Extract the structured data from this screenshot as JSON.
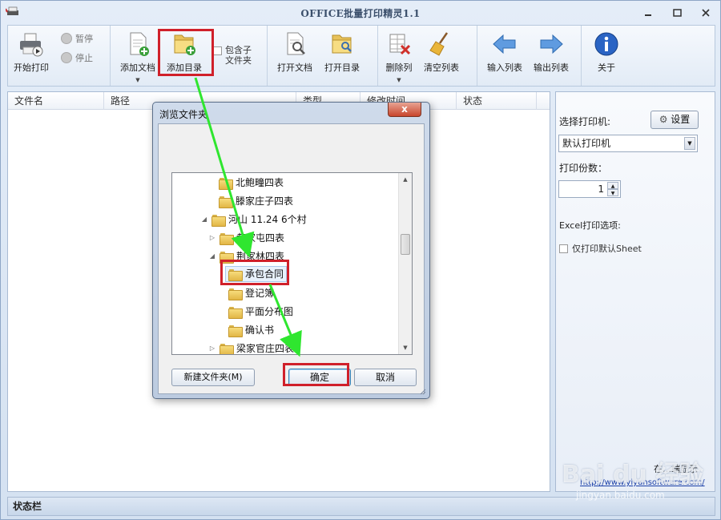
{
  "window": {
    "title": "OFFICE批量打印精灵1.1",
    "min": "▫",
    "max": "□",
    "close": "✕"
  },
  "toolbar": {
    "start_print": "开始打印",
    "pause": "暂停",
    "stop": "停止",
    "add_doc": "添加文档",
    "add_dir": "添加目录",
    "include_sub": "包含子\n文件夹",
    "open_doc": "打开文档",
    "open_dir": "打开目录",
    "delete_col": "删除列",
    "clear_list": "清空列表",
    "import_list": "输入列表",
    "export_list": "输出列表",
    "about": "关于"
  },
  "table": {
    "columns": [
      "文件名",
      "路径",
      "类型",
      "修改时间",
      "状态"
    ]
  },
  "side": {
    "printer_label": "选择打印机:",
    "settings_button": "设置",
    "printer_value": "默认打印机",
    "copies_label": "打印份数：",
    "copies_value": "1",
    "excel_label": "Excel打印选项:",
    "only_default_sheet": "仅打印默认Sheet",
    "partial_display": "在…端显示",
    "url": "http://www.yiyunsoftware.com/"
  },
  "statusbar": {
    "label": "状态栏"
  },
  "dialog": {
    "title": "浏览文件夹",
    "close": "x",
    "tree": [
      {
        "label": "北鲍疃四表"
      },
      {
        "label": "滕家庄子四表"
      },
      {
        "label": "河山 11.24  6个村"
      },
      {
        "label": "黄家屯四表"
      },
      {
        "label": "荆家林四表"
      },
      {
        "label": "承包合同"
      },
      {
        "label": "登记簿"
      },
      {
        "label": "平面分布图"
      },
      {
        "label": "确认书"
      },
      {
        "label": "梁家官庄四表"
      }
    ],
    "new_folder": "新建文件夹(M)",
    "ok": "确定",
    "cancel": "取消"
  },
  "watermark": {
    "brand": "Bai du 经验",
    "site": "jingyan.baidu.com"
  }
}
